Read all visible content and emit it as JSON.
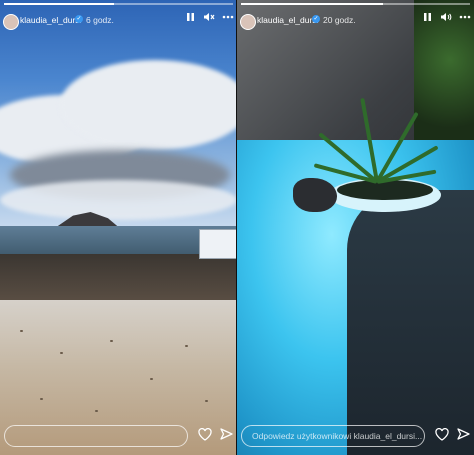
{
  "stories": [
    {
      "username": "klaudia_el_dursi",
      "time_ago": "6 godz.",
      "reply_placeholder": "",
      "icons": [
        "pause-icon",
        "mute-icon",
        "more-icon",
        "heart-icon",
        "send-icon"
      ],
      "progress": 0.48
    },
    {
      "username": "klaudia_el_dursi",
      "time_ago": "20 godz.",
      "reply_placeholder": "Odpowiedz użytkownikowi klaudia_el_dursi...",
      "icons": [
        "pause-icon",
        "mute-icon",
        "more-icon",
        "heart-icon",
        "send-icon"
      ],
      "progress": 0.62
    }
  ],
  "colors": {
    "verified_badge": "#3897f0",
    "pool_water": "#3cc4ef",
    "sky": "#4b86cf"
  }
}
